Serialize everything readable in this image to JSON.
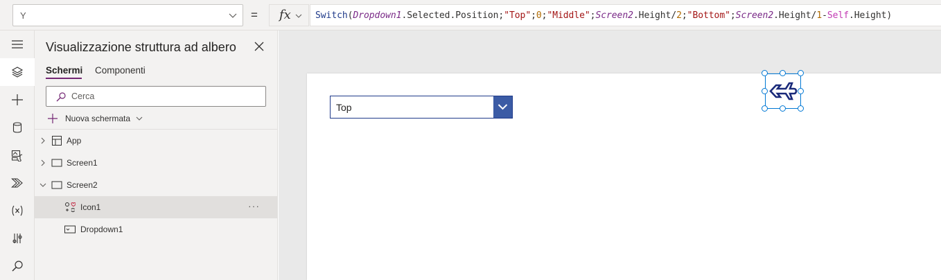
{
  "formula_bar": {
    "property_value": "Y",
    "equals": "=",
    "fx_label": "fx",
    "formula_tokens": [
      {
        "t": "Switch",
        "k": "fn"
      },
      {
        "t": "(",
        "k": "p"
      },
      {
        "t": "Dropdown1",
        "k": "ctl"
      },
      {
        "t": ".Selected.Position;",
        "k": "p"
      },
      {
        "t": "\"Top\"",
        "k": "str"
      },
      {
        "t": ";",
        "k": "p"
      },
      {
        "t": "0",
        "k": "num"
      },
      {
        "t": ";",
        "k": "p"
      },
      {
        "t": "\"Middle\"",
        "k": "str"
      },
      {
        "t": ";",
        "k": "p"
      },
      {
        "t": "Screen2",
        "k": "ctl"
      },
      {
        "t": ".Height/",
        "k": "p"
      },
      {
        "t": "2",
        "k": "num"
      },
      {
        "t": ";",
        "k": "p"
      },
      {
        "t": "\"Bottom\"",
        "k": "str"
      },
      {
        "t": ";",
        "k": "p"
      },
      {
        "t": "Screen2",
        "k": "ctl"
      },
      {
        "t": ".Height/",
        "k": "p"
      },
      {
        "t": "1",
        "k": "num"
      },
      {
        "t": "-",
        "k": "p"
      },
      {
        "t": "Self",
        "k": "self"
      },
      {
        "t": ".Height)",
        "k": "p"
      }
    ]
  },
  "rail": {
    "items": [
      {
        "name": "hamburger-menu-icon",
        "active": false
      },
      {
        "name": "tree-view-layers-icon",
        "active": true
      },
      {
        "name": "insert-plus-icon",
        "active": false
      },
      {
        "name": "data-cylinder-icon",
        "active": false
      },
      {
        "name": "media-icon",
        "active": false
      },
      {
        "name": "power-automate-icon",
        "active": false
      },
      {
        "name": "variables-icon",
        "active": false
      },
      {
        "name": "advanced-tools-icon",
        "active": false
      },
      {
        "name": "search-icon",
        "active": false
      }
    ]
  },
  "tree_panel": {
    "title": "Visualizzazione struttura ad albero",
    "tabs": [
      {
        "label": "Schermi",
        "selected": true
      },
      {
        "label": "Componenti",
        "selected": false
      }
    ],
    "search_placeholder": "Cerca",
    "new_screen_label": "Nuova schermata",
    "nodes": [
      {
        "label": "App",
        "icon": "app-icon",
        "caret": "collapsed",
        "level": 0
      },
      {
        "label": "Screen1",
        "icon": "screen-icon",
        "caret": "collapsed",
        "level": 0
      },
      {
        "label": "Screen2",
        "icon": "screen-icon",
        "caret": "expanded",
        "level": 0
      },
      {
        "label": "Icon1",
        "icon": "icons-control-icon",
        "caret": "none",
        "level": 1,
        "selected": true,
        "more": "···"
      },
      {
        "label": "Dropdown1",
        "icon": "dropdown-control-icon",
        "caret": "none",
        "level": 1
      }
    ]
  },
  "canvas": {
    "dropdown_value": "Top",
    "icon_name": "airplane-icon"
  },
  "colors": {
    "accent": "#742774",
    "selection": "#0078d4",
    "dropdown_button": "#3b5ba5",
    "icon_color": "#1a2a7a"
  }
}
